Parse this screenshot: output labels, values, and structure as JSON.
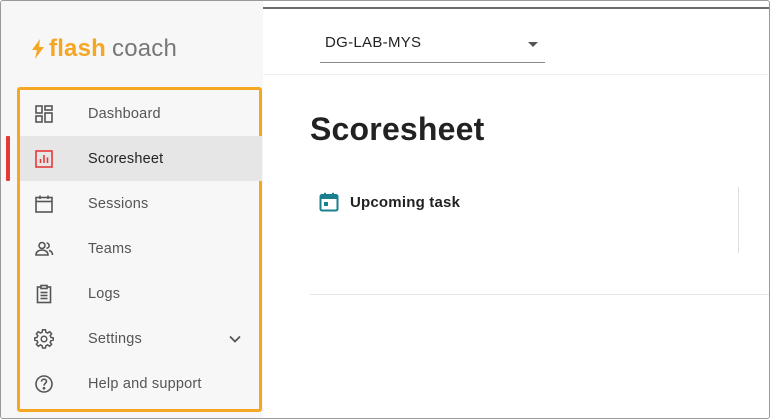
{
  "brand": {
    "flash": "flash",
    "coach": "coach",
    "accent_color": "#f5a623",
    "bolt_icon": "lightning-bolt-icon"
  },
  "header": {
    "location_select": {
      "value": "DG-LAB-MYS",
      "icon": "caret-down-icon"
    }
  },
  "sidebar": {
    "highlight_color": "#f5a623",
    "active_indicator_color": "#e53935",
    "items": [
      {
        "label": "Dashboard",
        "icon": "dashboard-grid-icon"
      },
      {
        "label": "Scoresheet",
        "icon": "bar-chart-icon",
        "active": true
      },
      {
        "label": "Sessions",
        "icon": "calendar-icon"
      },
      {
        "label": "Teams",
        "icon": "people-icon"
      },
      {
        "label": "Logs",
        "icon": "clipboard-icon"
      },
      {
        "label": "Settings",
        "icon": "gear-icon",
        "expandable": true,
        "expand_icon": "chevron-down-icon"
      },
      {
        "label": "Help and support",
        "icon": "help-circle-icon"
      }
    ]
  },
  "main": {
    "title": "Scoresheet",
    "upcoming_task": {
      "label": "Upcoming task",
      "icon": "calendar-icon",
      "icon_color": "#1a7f8f"
    }
  }
}
